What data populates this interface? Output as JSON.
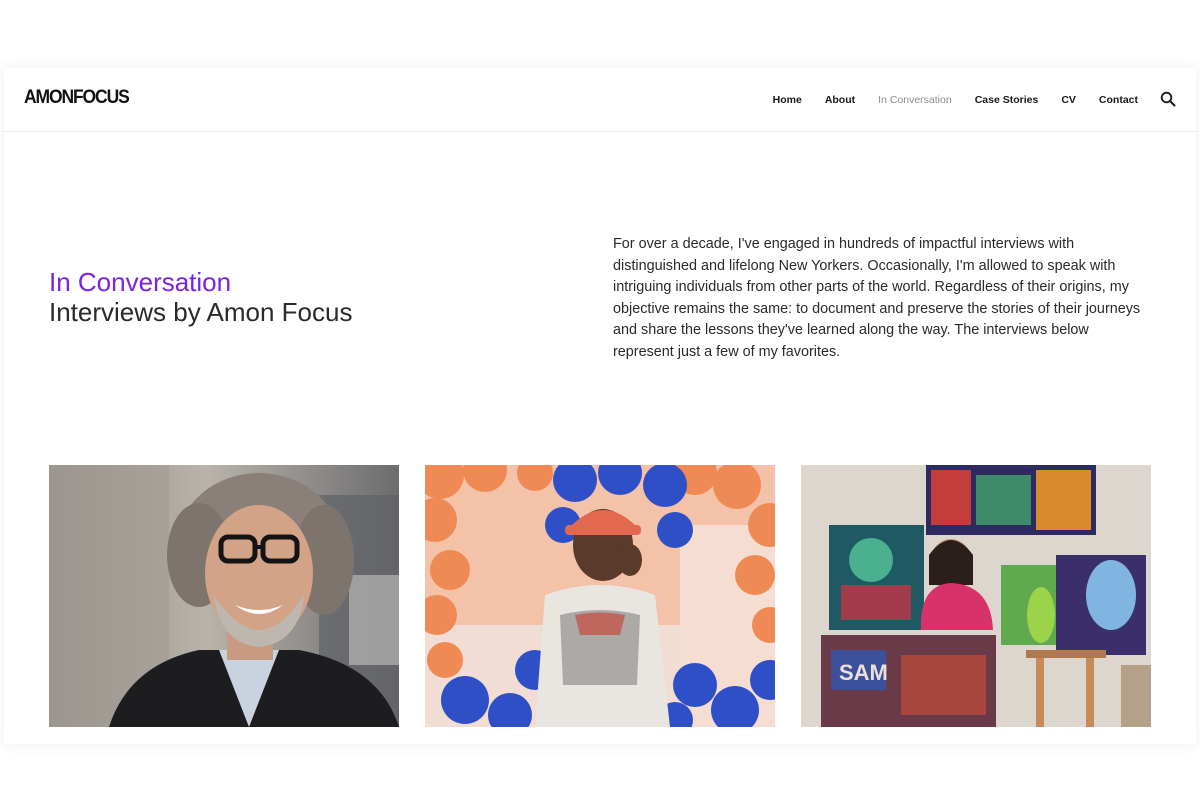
{
  "site": {
    "logo": "AMONFOCUS"
  },
  "nav": {
    "items": [
      {
        "label": "Home",
        "active": false
      },
      {
        "label": "About",
        "active": false
      },
      {
        "label": "In Conversation",
        "active": true
      },
      {
        "label": "Case Stories",
        "active": false
      },
      {
        "label": "CV",
        "active": false
      },
      {
        "label": "Contact",
        "active": false
      }
    ],
    "search_icon": "search-icon"
  },
  "hero": {
    "title": "In Conversation",
    "subtitle": "Interviews by Amon Focus",
    "intro": "For over a decade, I've engaged in hundreds of impactful interviews with distinguished and lifelong New Yorkers. Occasionally, I'm allowed to speak with intriguing individuals from other parts of the world. Regardless of their origins, my objective remains the same: to document and preserve the stories of their journeys and share the lessons they've learned along the way. The interviews below represent just a few of my favorites."
  },
  "colors": {
    "accent": "#7a22e6",
    "text": "#2a2a2a",
    "nav_active": "#8c8c8c"
  }
}
